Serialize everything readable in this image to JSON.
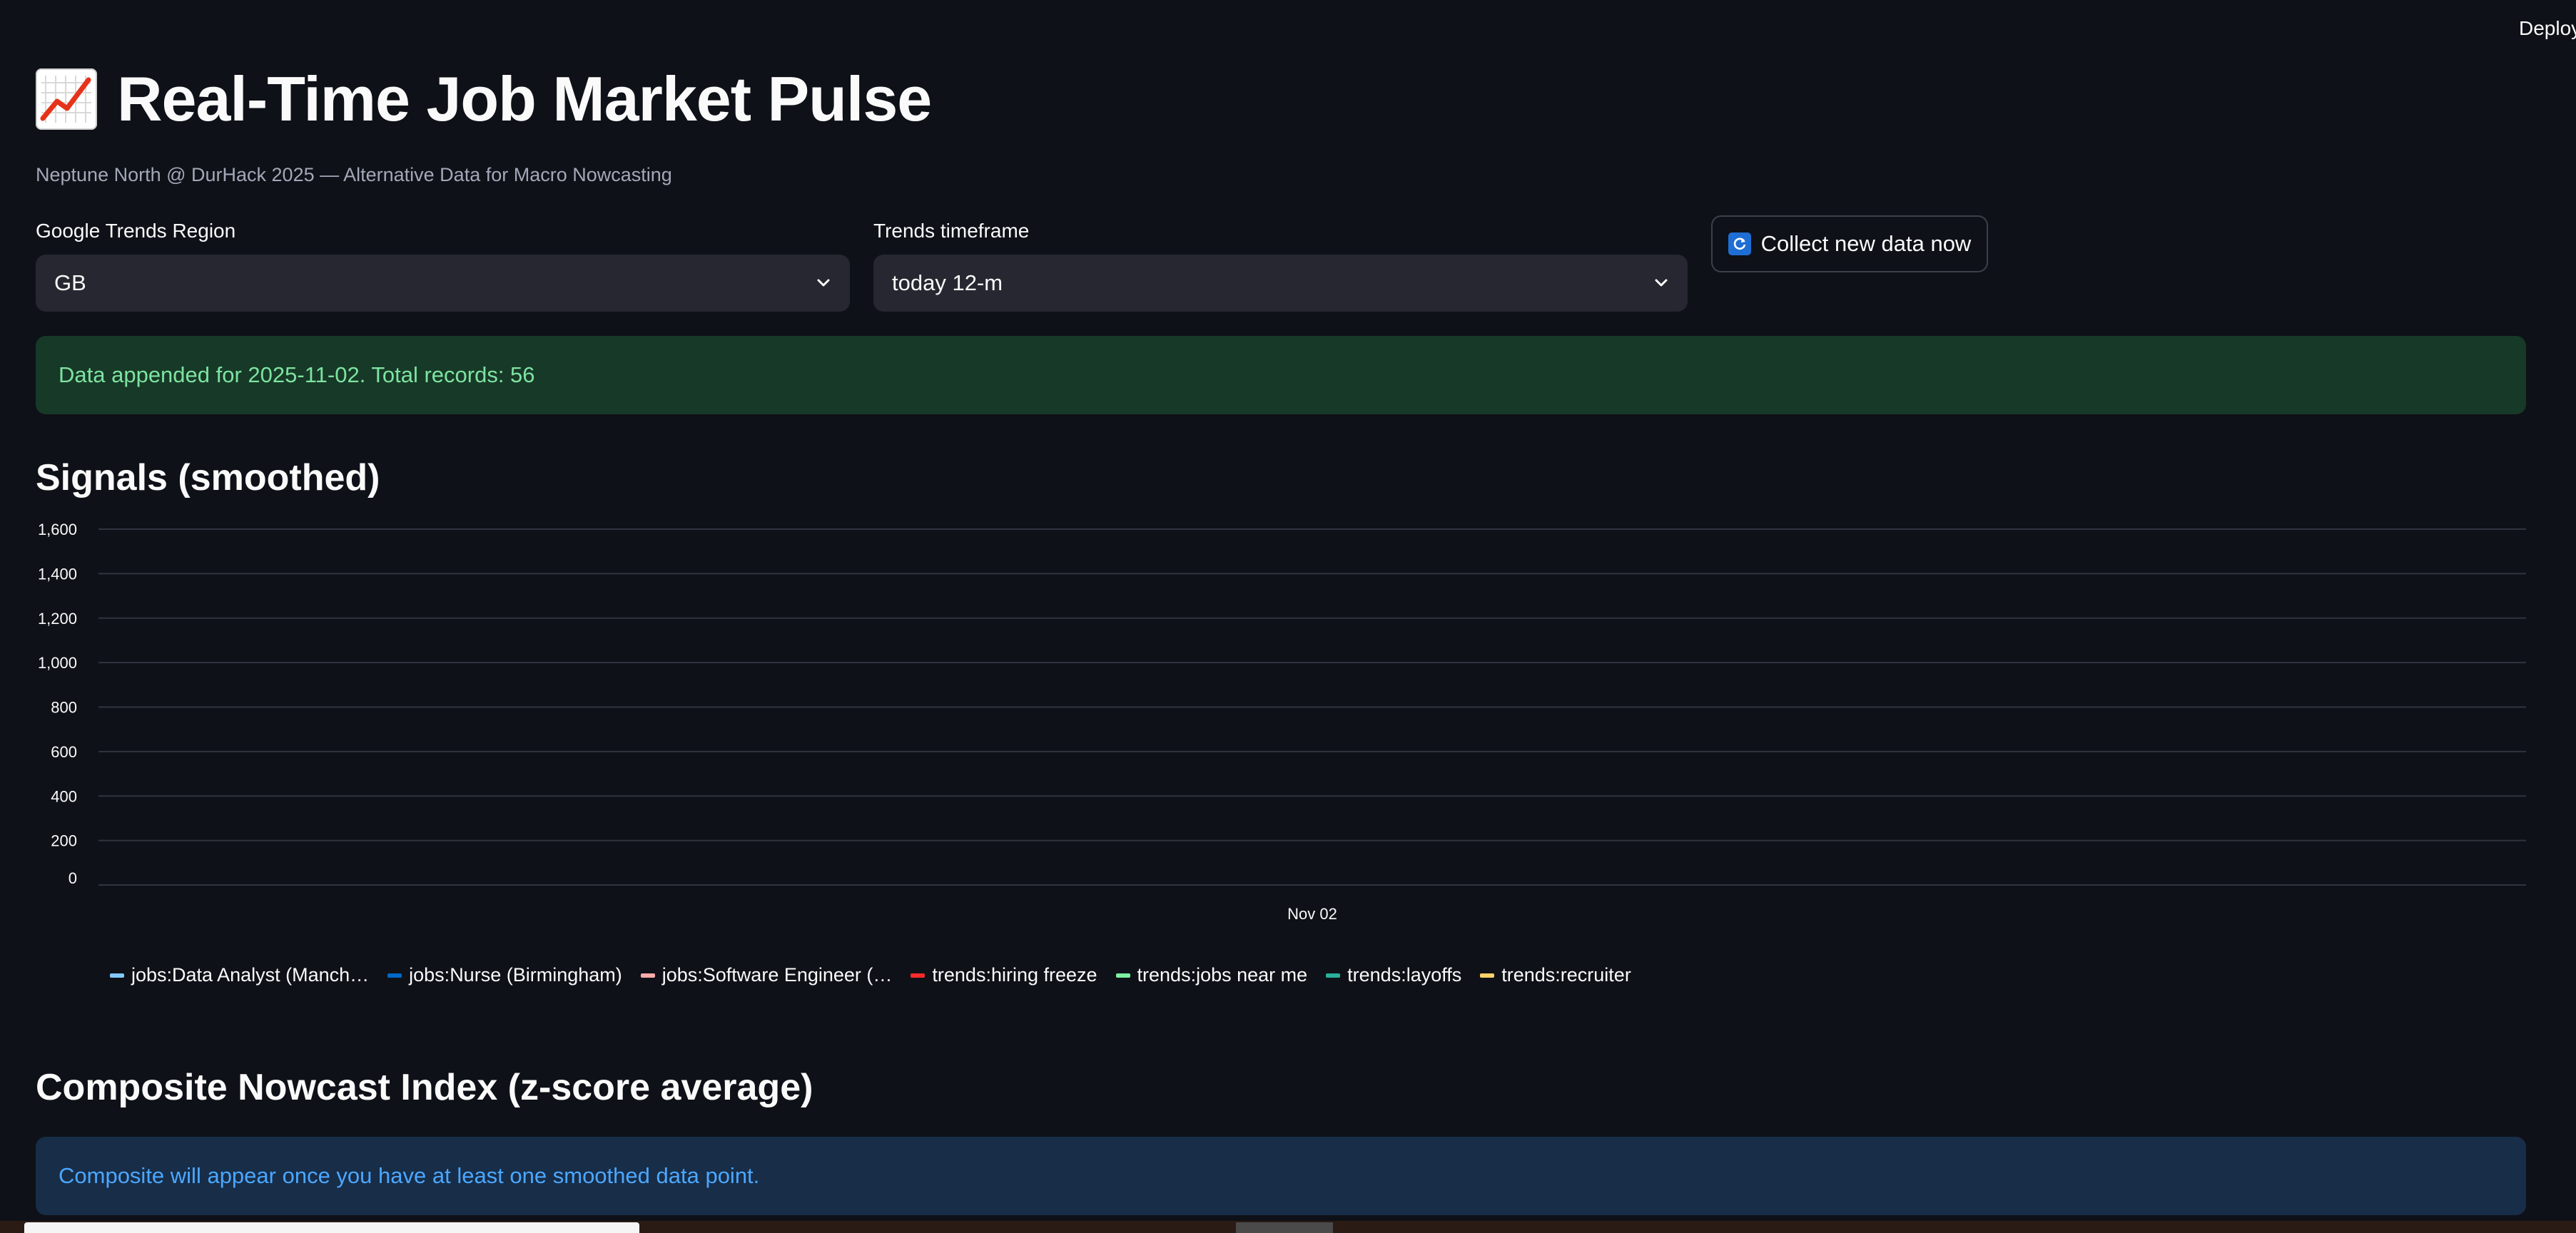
{
  "header": {
    "deploy_label": "Deploy"
  },
  "page": {
    "title": "Real-Time Job Market Pulse",
    "subtitle": "Neptune North @ DurHack 2025 — Alternative Data for Macro Nowcasting"
  },
  "controls": {
    "region_label": "Google Trends Region",
    "region_value": "GB",
    "timeframe_label": "Trends timeframe",
    "timeframe_value": "today 12-m",
    "collect_button": "Collect new data now"
  },
  "alerts": {
    "success": "Data appended for 2025-11-02. Total records: 56",
    "info": "Composite will appear once you have at least one smoothed data point."
  },
  "sections": {
    "signals_title": "Signals (smoothed)",
    "composite_title": "Composite Nowcast Index (z-score average)"
  },
  "chart_data": {
    "type": "line",
    "title": "",
    "xlabel": "",
    "ylabel": "",
    "ylim": [
      0,
      1600
    ],
    "yticks": [
      "1,600",
      "1,400",
      "1,200",
      "1,000",
      "800",
      "600",
      "400",
      "200",
      "0"
    ],
    "x_ticks": [
      "Nov 02"
    ],
    "grid": true,
    "legend_position": "bottom",
    "series": [
      {
        "name": "jobs:Data Analyst (Manch…",
        "color": "#83c9ff",
        "values": []
      },
      {
        "name": "jobs:Nurse (Birmingham)",
        "color": "#0068c9",
        "values": []
      },
      {
        "name": "jobs:Software Engineer (…",
        "color": "#ffabab",
        "values": []
      },
      {
        "name": "trends:hiring freeze",
        "color": "#ff2b2b",
        "values": []
      },
      {
        "name": "trends:jobs near me",
        "color": "#7defa1",
        "values": []
      },
      {
        "name": "trends:layoffs",
        "color": "#29b09d",
        "values": []
      },
      {
        "name": "trends:recruiter",
        "color": "#ffd16a",
        "values": []
      }
    ]
  }
}
